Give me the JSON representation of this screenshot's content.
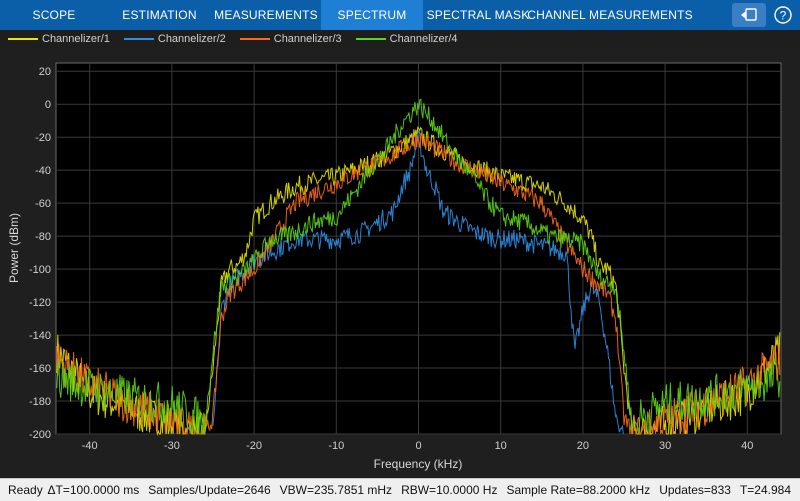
{
  "toolstrip": {
    "tabs": [
      {
        "label": "SCOPE",
        "active": false
      },
      {
        "label": "ESTIMATION",
        "active": false
      },
      {
        "label": "MEASUREMENTS",
        "active": false
      },
      {
        "label": "SPECTRUM",
        "active": true
      },
      {
        "label": "SPECTRAL MASK",
        "active": false
      },
      {
        "label": "CHANNEL MEASUREMENTS",
        "active": false
      }
    ],
    "icons": [
      "undock-icon",
      "help-icon"
    ]
  },
  "legend": {
    "entries": [
      {
        "name": "Channelizer/1",
        "color": "#e6e600"
      },
      {
        "name": "Channelizer/2",
        "color": "#2f8fe6"
      },
      {
        "name": "Channelizer/3",
        "color": "#ff6a1a"
      },
      {
        "name": "Channelizer/4",
        "color": "#5cd616"
      }
    ]
  },
  "plot": {
    "xlabel": "Frequency (kHz)",
    "ylabel": "Power (dBm)",
    "xticks": [
      -40,
      -30,
      -20,
      -10,
      0,
      10,
      20,
      30,
      40
    ],
    "yticks": [
      20,
      0,
      -20,
      -40,
      -60,
      -80,
      -100,
      -120,
      -140,
      -160,
      -180,
      -200
    ]
  },
  "chart_data": {
    "type": "line",
    "xlabel": "Frequency (kHz)",
    "ylabel": "Power (dBm)",
    "xlim": [
      -44.1,
      44.1
    ],
    "ylim": [
      -200,
      25
    ],
    "grid": true,
    "legend_position": "top",
    "series": [
      {
        "name": "Channelizer/1",
        "color": "#e6e600",
        "x": [
          -44,
          -40,
          -35,
          -30,
          -27,
          -26,
          -25,
          -24,
          -23,
          -22,
          -21,
          -20,
          -18,
          -15,
          -12,
          -10,
          -7,
          -5,
          -3,
          -1,
          0,
          1,
          3,
          5,
          7,
          10,
          12,
          15,
          18,
          20,
          21,
          22,
          23,
          24,
          25,
          26,
          27,
          30,
          35,
          40,
          44
        ],
        "y": [
          -150,
          -175,
          -185,
          -195,
          -200,
          -200,
          -160,
          -110,
          -100,
          -98,
          -90,
          -70,
          -60,
          -50,
          -46,
          -44,
          -38,
          -34,
          -28,
          -22,
          -18,
          -22,
          -28,
          -34,
          -38,
          -44,
          -46,
          -50,
          -60,
          -70,
          -80,
          -98,
          -100,
          -110,
          -160,
          -200,
          -200,
          -195,
          -185,
          -175,
          -150
        ]
      },
      {
        "name": "Channelizer/2",
        "color": "#2f8fe6",
        "x": [
          -25,
          -24,
          -23,
          -22,
          -21,
          -20,
          -18,
          -15,
          -12,
          -10,
          -7,
          -5,
          -3,
          -2,
          -1,
          0,
          1,
          2,
          3,
          5,
          7,
          10,
          12,
          15,
          18,
          19,
          20,
          21,
          22,
          23,
          24,
          25
        ],
        "y": [
          -200,
          -125,
          -110,
          -105,
          -100,
          -95,
          -90,
          -82,
          -82,
          -82,
          -78,
          -72,
          -65,
          -50,
          -40,
          -20,
          -40,
          -50,
          -65,
          -72,
          -78,
          -82,
          -82,
          -86,
          -90,
          -150,
          -125,
          -110,
          -120,
          -150,
          -190,
          -200
        ]
      },
      {
        "name": "Channelizer/3",
        "color": "#ff6a1a",
        "x": [
          -44,
          -40,
          -35,
          -30,
          -27,
          -26,
          -25,
          -24,
          -23,
          -22,
          -21,
          -20,
          -18,
          -15,
          -12,
          -10,
          -7,
          -5,
          -3,
          -1,
          0,
          1,
          3,
          5,
          7,
          10,
          12,
          15,
          18,
          20,
          21,
          22,
          23,
          24,
          25,
          26,
          27,
          30,
          35,
          40,
          44
        ],
        "y": [
          -155,
          -170,
          -182,
          -192,
          -200,
          -200,
          -190,
          -130,
          -115,
          -110,
          -105,
          -100,
          -85,
          -60,
          -52,
          -48,
          -40,
          -36,
          -30,
          -24,
          -20,
          -24,
          -30,
          -36,
          -40,
          -48,
          -52,
          -60,
          -85,
          -100,
          -105,
          -110,
          -115,
          -130,
          -190,
          -200,
          -200,
          -192,
          -182,
          -170,
          -155
        ]
      },
      {
        "name": "Channelizer/4",
        "color": "#5cd616",
        "x": [
          -44,
          -40,
          -35,
          -30,
          -27,
          -26,
          -25,
          -24,
          -23,
          -22,
          -21,
          -20,
          -18,
          -16,
          -13,
          -10,
          -8,
          -6,
          -4,
          -2,
          0,
          2,
          4,
          6,
          8,
          10,
          13,
          16,
          18,
          20,
          21,
          22,
          23,
          24,
          25,
          26,
          27,
          30,
          35,
          40,
          44
        ],
        "y": [
          -165,
          -172,
          -178,
          -182,
          -190,
          -196,
          -150,
          -110,
          -108,
          -105,
          -100,
          -95,
          -82,
          -80,
          -72,
          -68,
          -55,
          -40,
          -28,
          -12,
          0,
          -12,
          -28,
          -40,
          -55,
          -68,
          -72,
          -80,
          -82,
          -85,
          -95,
          -105,
          -108,
          -110,
          -150,
          -196,
          -190,
          -182,
          -178,
          -172,
          -165
        ]
      }
    ]
  },
  "status": {
    "ready": "Ready",
    "items": [
      "ΔT=100.0000 ms",
      "Samples/Update=2646",
      "VBW=235.7851 mHz",
      "RBW=10.0000 Hz",
      "Sample Rate=88.2000 kHz",
      "Updates=833",
      "T=24.984"
    ]
  }
}
